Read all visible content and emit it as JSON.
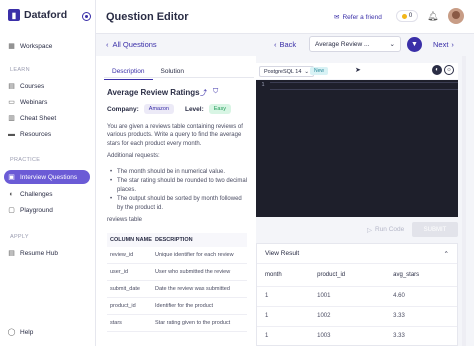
{
  "brand": {
    "name": "Dataford"
  },
  "sidebar": {
    "items_top": [
      {
        "label": "Workspace",
        "icon": "grid-icon"
      }
    ],
    "learn_label": "LEARN",
    "learn_items": [
      {
        "label": "Courses"
      },
      {
        "label": "Webinars"
      },
      {
        "label": "Cheat Sheet"
      },
      {
        "label": "Resources"
      }
    ],
    "practice_label": "PRACTICE",
    "practice_items": [
      {
        "label": "Interview Questions",
        "active": true
      },
      {
        "label": "Challenges"
      },
      {
        "label": "Playground"
      }
    ],
    "apply_label": "APPLY",
    "apply_items": [
      {
        "label": "Resume Hub"
      }
    ],
    "help_label": "Help"
  },
  "header": {
    "title": "Question Editor",
    "referral": "Refer a friend",
    "coins": "0"
  },
  "nav": {
    "all_questions": "All Questions",
    "back": "Back",
    "question_select": "Average Review ...",
    "next": "Next"
  },
  "question": {
    "tabs": [
      "Description",
      "Solution"
    ],
    "title": "Average Review Ratings",
    "company_label": "Company:",
    "company": "Amazon",
    "level_label": "Level:",
    "level": "Easy",
    "description": "You are given a reviews table containing reviews of various products. Write a query to find the average stars for each product every month.",
    "requests_title": "Additional requests:",
    "requests": [
      "The month should be in numerical value.",
      "The star rating should be rounded to two decimal places.",
      "The output should be sorted by month followed by the product id."
    ],
    "table_name": "reviews table",
    "schema_headers": [
      "COLUMN NAME",
      "DESCRIPTION"
    ],
    "schema_rows": [
      [
        "review_id",
        "Unique identifier for each review"
      ],
      [
        "user_id",
        "User who submitted the review"
      ],
      [
        "submit_date",
        "Date the review was submitted"
      ],
      [
        "product_id",
        "Identifier for the product"
      ],
      [
        "stars",
        "Star rating given to the product"
      ]
    ]
  },
  "editor": {
    "language": "PostgreSQL 14",
    "badge": "New",
    "line_number": "1",
    "run_label": "Run Code",
    "submit_label": "SUBMIT"
  },
  "result": {
    "title": "View Result",
    "headers": [
      "month",
      "product_id",
      "avg_stars"
    ],
    "rows": [
      [
        "1",
        "1001",
        "4.60"
      ],
      [
        "1",
        "1002",
        "3.33"
      ],
      [
        "1",
        "1003",
        "3.33"
      ]
    ]
  }
}
